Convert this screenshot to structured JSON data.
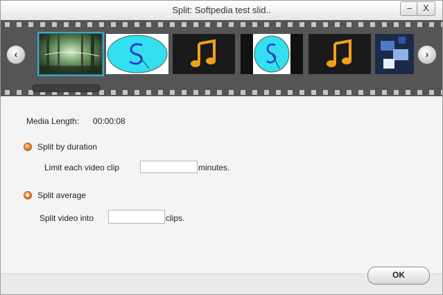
{
  "window": {
    "title": "Split: Softpedia test slid..",
    "minimize_label": "–",
    "close_label": "X"
  },
  "filmstrip": {
    "prev_icon": "chevron-left-icon",
    "next_icon": "chevron-right-icon",
    "prev_label": "‹",
    "next_label": "›",
    "thumbnails": [
      {
        "kind": "forest-photo",
        "selected": true
      },
      {
        "kind": "s-logo-circle"
      },
      {
        "kind": "music-note"
      },
      {
        "kind": "s-logo-narrow"
      },
      {
        "kind": "music-note"
      },
      {
        "kind": "partial-image"
      }
    ]
  },
  "media": {
    "length_label": "Media Length:",
    "length_value": "00:00:08"
  },
  "split_by_duration": {
    "label": "Split by duration",
    "selected": false,
    "prefix": "Limit each video clip",
    "value": "",
    "suffix": "minutes."
  },
  "split_average": {
    "label": "Split average",
    "selected": true,
    "prefix": "Split video into",
    "value": "",
    "suffix": "clips."
  },
  "ok_label": "OK",
  "colors": {
    "accent_orange": "#e4741a",
    "selection_blue": "#29b0d8",
    "film_gray": "#555555"
  }
}
